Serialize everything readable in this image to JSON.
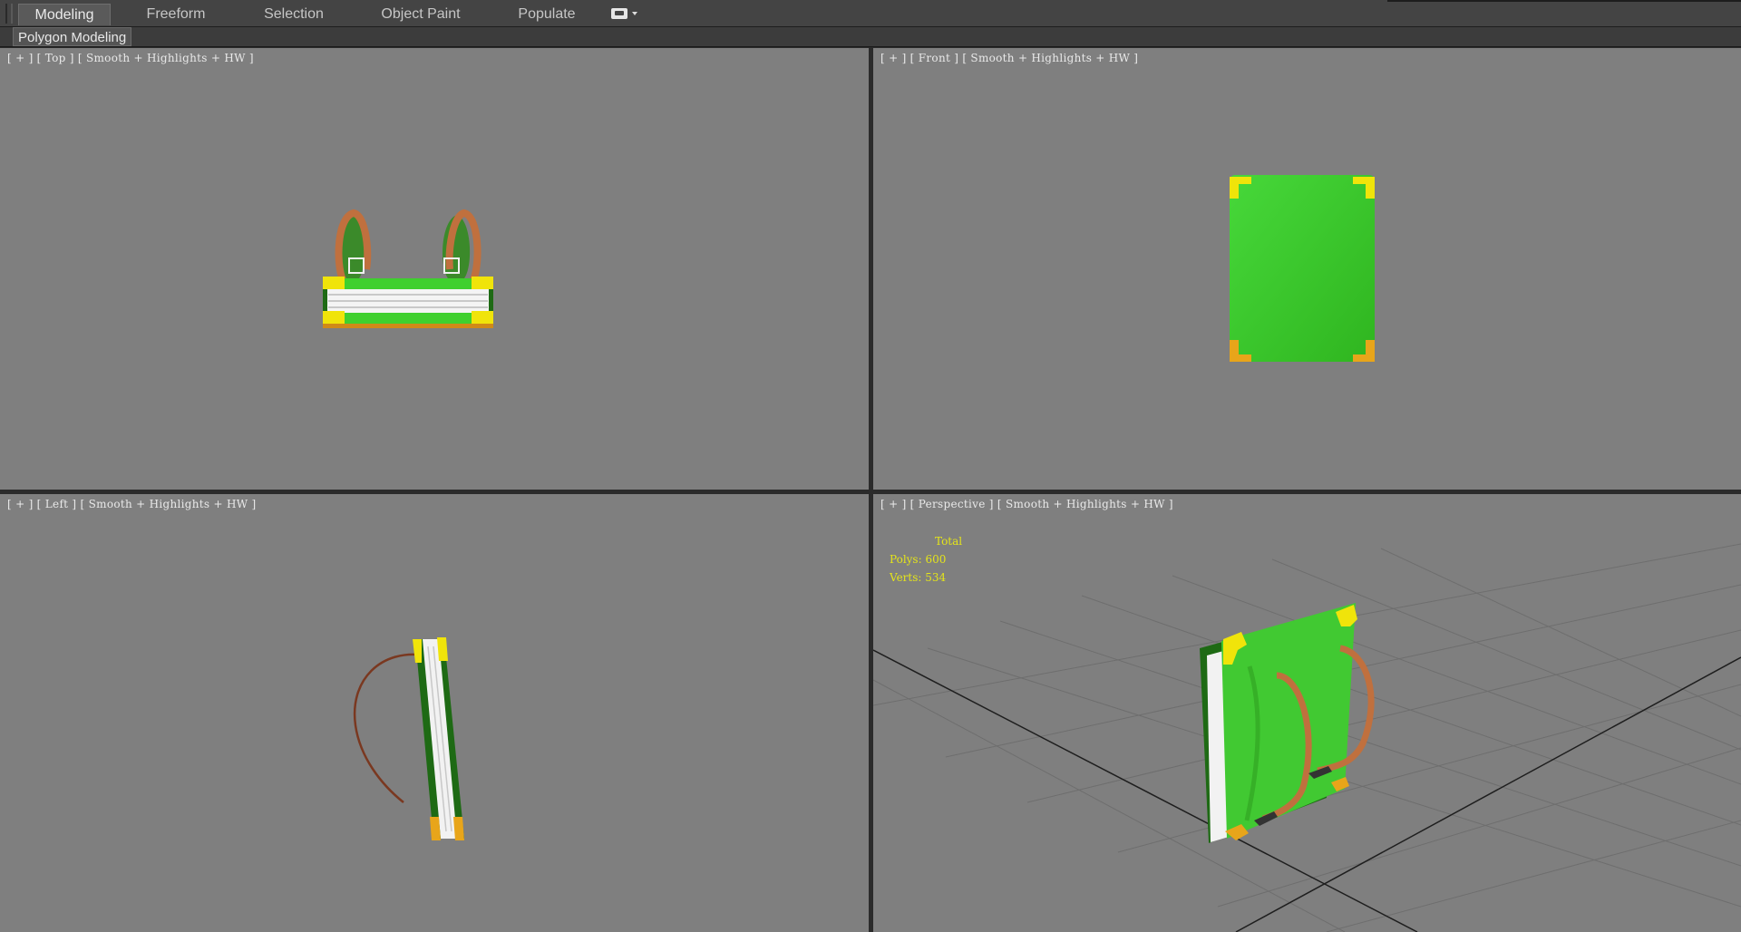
{
  "ribbon": {
    "tabs": [
      {
        "label": "Modeling",
        "active": true
      },
      {
        "label": "Freeform",
        "active": false
      },
      {
        "label": "Selection",
        "active": false
      },
      {
        "label": "Object Paint",
        "active": false
      },
      {
        "label": "Populate",
        "active": false
      }
    ],
    "more_icon": "ribbon-options-icon",
    "panel_label": "Polygon Modeling"
  },
  "viewports": {
    "top": {
      "plus": "[ + ]",
      "view": "[ Top ]",
      "shading": "[ Smooth + Highlights + HW ]"
    },
    "front": {
      "plus": "[ + ]",
      "view": "[ Front ]",
      "shading": "[ Smooth + Highlights + HW ]"
    },
    "left": {
      "plus": "[ + ]",
      "view": "[ Left ]",
      "shading": "[ Smooth + Highlights + HW ]"
    },
    "perspective": {
      "plus": "[ + ]",
      "view": "[ Perspective ]",
      "shading": "[ Smooth + Highlights + HW ]"
    }
  },
  "stats": {
    "header": "Total",
    "polys_label": "Polys:",
    "polys_value": "600",
    "verts_label": "Verts:",
    "verts_value": "534"
  },
  "colors": {
    "viewport_bg": "#7f7f7f",
    "book_green": "#3fcc2f",
    "corner_yellow": "#f0e40a",
    "corner_orange": "#e8a51a",
    "strap_brown": "#b8683a",
    "stats_yellow": "#e4e41a"
  }
}
